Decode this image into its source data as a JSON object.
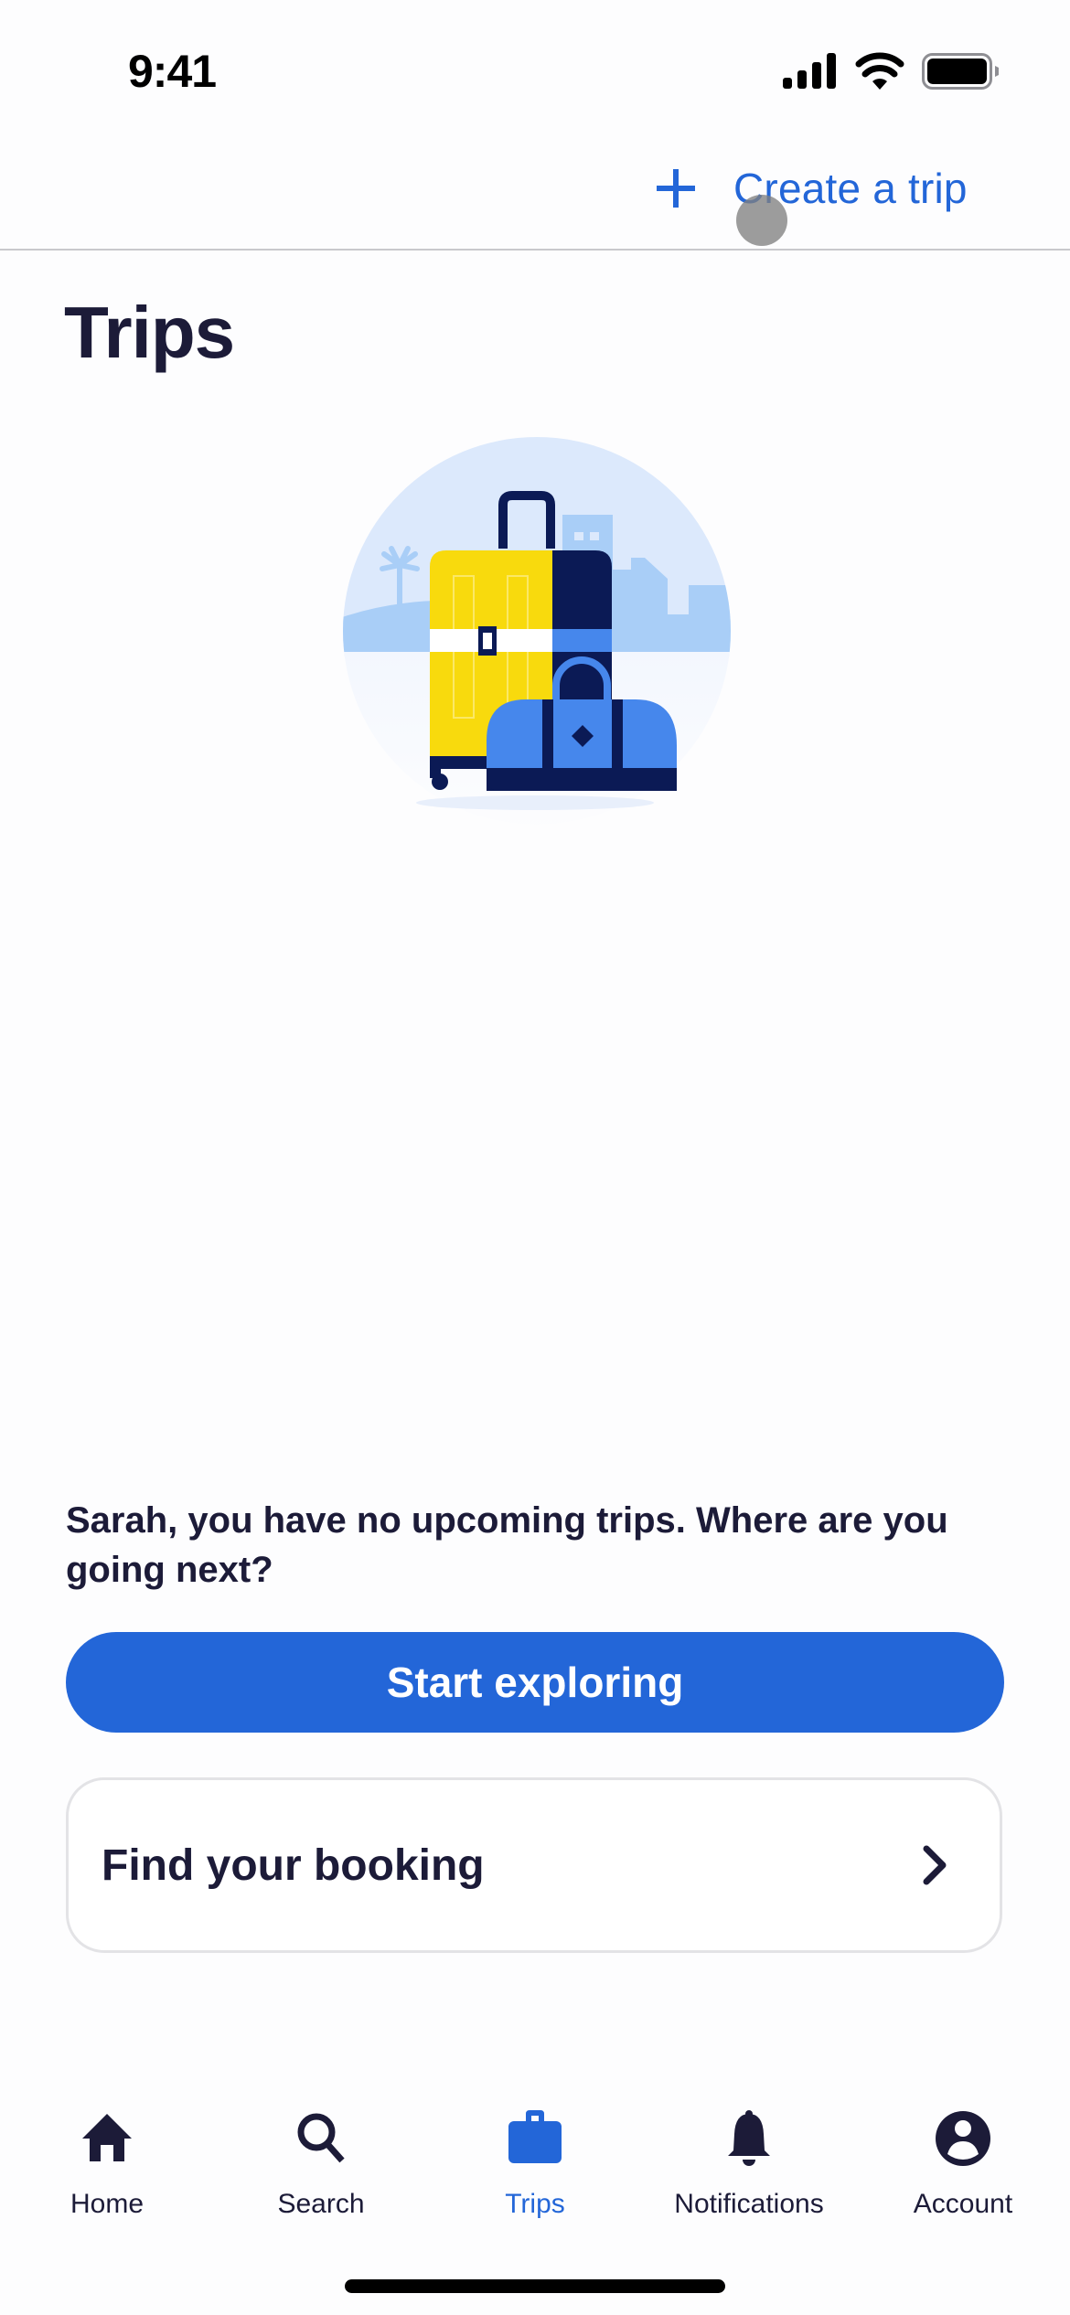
{
  "status_bar": {
    "time": "9:41",
    "icons": [
      "cellular-signal-icon",
      "wifi-icon",
      "battery-icon"
    ]
  },
  "header": {
    "action_icon": "plus-icon",
    "action_label": "Create a trip"
  },
  "page": {
    "title": "Trips",
    "illustration": "luggage-illustration",
    "message": "Sarah, you have no upcoming trips. Where are you going next?"
  },
  "actions": {
    "primary_label": "Start exploring",
    "booking_label": "Find your booking",
    "booking_icon": "chevron-right-icon"
  },
  "tabbar": {
    "active": "Trips",
    "items": [
      {
        "label": "Home",
        "icon": "home-icon"
      },
      {
        "label": "Search",
        "icon": "search-icon"
      },
      {
        "label": "Trips",
        "icon": "briefcase-icon"
      },
      {
        "label": "Notifications",
        "icon": "bell-icon"
      },
      {
        "label": "Account",
        "icon": "account-icon"
      }
    ]
  },
  "colors": {
    "accent": "#2366D8",
    "text_primary": "#1C1B38",
    "divider": "#C9C9CC",
    "card_border": "#E3E3E6",
    "illustration_yellow": "#F8DA0D",
    "illustration_navy": "#0B1A55",
    "illustration_blue": "#4687EC",
    "illustration_sky": "#DCE9FC",
    "illustration_skyline": "#A9CEF7"
  }
}
